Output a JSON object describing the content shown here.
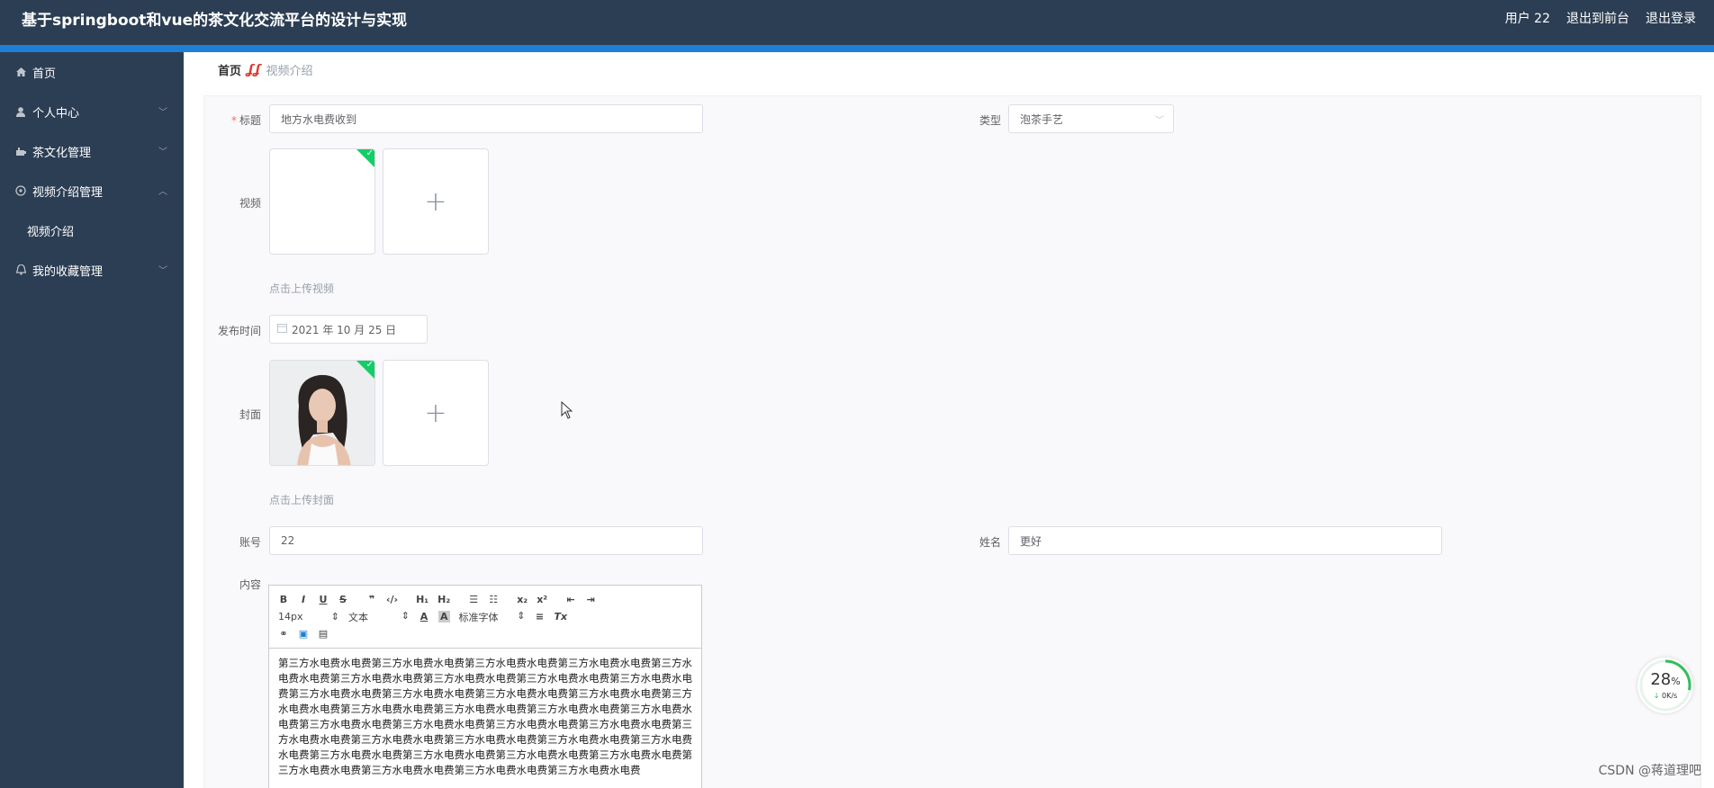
{
  "header": {
    "title": "基于springboot和vue的茶文化交流平台的设计与实现",
    "user": "用户 22",
    "back_to_front": "退出到前台",
    "logout": "退出登录"
  },
  "sidebar": {
    "items": [
      {
        "label": "首页",
        "icon": "home-icon"
      },
      {
        "label": "个人中心",
        "icon": "user-icon"
      },
      {
        "label": "茶文化管理",
        "icon": "tea-icon"
      },
      {
        "label": "视频介绍管理",
        "icon": "video-icon"
      },
      {
        "label": "我的收藏管理",
        "icon": "bell-icon"
      }
    ],
    "submenu": {
      "label": "视频介绍"
    }
  },
  "breadcrumb": {
    "home": "首页",
    "current": "视频介绍"
  },
  "form": {
    "title_label": "标题",
    "title_value": "地方水电费收到",
    "type_label": "类型",
    "type_value": "泡茶手艺",
    "video_label": "视频",
    "video_hint": "点击上传视频",
    "date_label": "发布时间",
    "date_value": "2021 年 10 月 25 日",
    "cover_label": "封面",
    "cover_hint": "点击上传封面",
    "account_label": "账号",
    "account_value": "22",
    "name_label": "姓名",
    "name_value": "更好",
    "content_label": "内容"
  },
  "editor": {
    "font_size": "14px",
    "block_format": "文本",
    "font_family": "标准字体",
    "content": "第三方水电费水电费第三方水电费水电费第三方水电费水电费第三方水电费水电费第三方水电费水电费第三方水电费水电费第三方水电费水电费第三方水电费水电费第三方水电费水电费第三方水电费水电费第三方水电费水电费第三方水电费水电费第三方水电费水电费第三方水电费水电费第三方水电费水电费第三方水电费水电费第三方水电费水电费第三方水电费水电费第三方水电费水电费第三方水电费水电费第三方水电费水电费第三方水电费水电费第三方水电费水电费第三方水电费水电费第三方水电费水电费第三方水电费水电费第三方水电费水电费第三方水电费水电费第三方水电费水电费第三方水电费水电费第三方水电费水电费第三方水电费水电费第三方水电费水电费第三方水电费水电费第三方水电费水电费"
  },
  "widget": {
    "percent": "28",
    "percent_unit": "%",
    "speed": "0K/s"
  },
  "watermark": "CSDN @蒋道理吧",
  "colors": {
    "header_bg": "#2c3e54",
    "accent": "#1e7fd6",
    "success": "#13ce66"
  }
}
